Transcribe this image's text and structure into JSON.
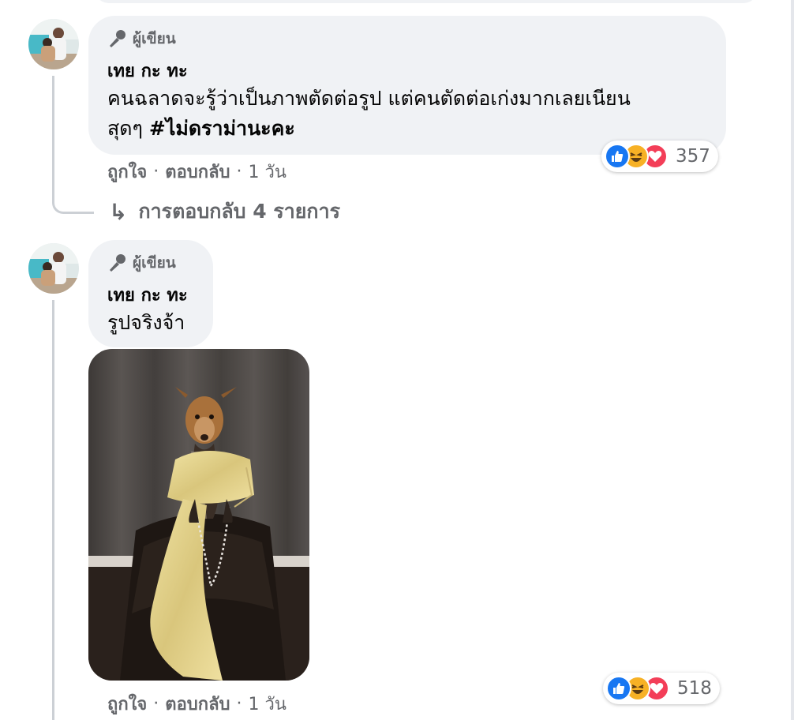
{
  "comments": [
    {
      "badge": "ผู้เขียน",
      "author": "เทย กะ ทะ",
      "text_line1": "คนฉลาดจะรู้ว่าเป็นภาพตัดต่อรูป แต่คนตัดต่อเก่งมากเลยเนียน",
      "text_line2_prefix": "สุดๆ ",
      "hashtag": "#ไม่ดราม่านะคะ",
      "like_label": "ถูกใจ",
      "reply_label": "ตอบกลับ",
      "time": "1 วัน",
      "reaction_count": "357",
      "reaction_icons": [
        "like-icon",
        "haha-icon",
        "love-icon"
      ],
      "view_replies": "การตอบกลับ 4 รายการ"
    },
    {
      "badge": "ผู้เขียน",
      "author": "เทย กะ ทะ",
      "text": "รูปจริงจ้า",
      "like_label": "ถูกใจ",
      "reply_label": "ตอบกลับ",
      "time": "1 วัน",
      "reaction_count": "518",
      "reaction_icons": [
        "like-icon",
        "haha-icon",
        "love-icon"
      ]
    }
  ],
  "colors": {
    "bubble": "#f0f2f5",
    "secondary_text": "#65676b",
    "like_blue": "#1877f2",
    "haha_yellow": "#f7b125",
    "love_red": "#f33e58"
  }
}
